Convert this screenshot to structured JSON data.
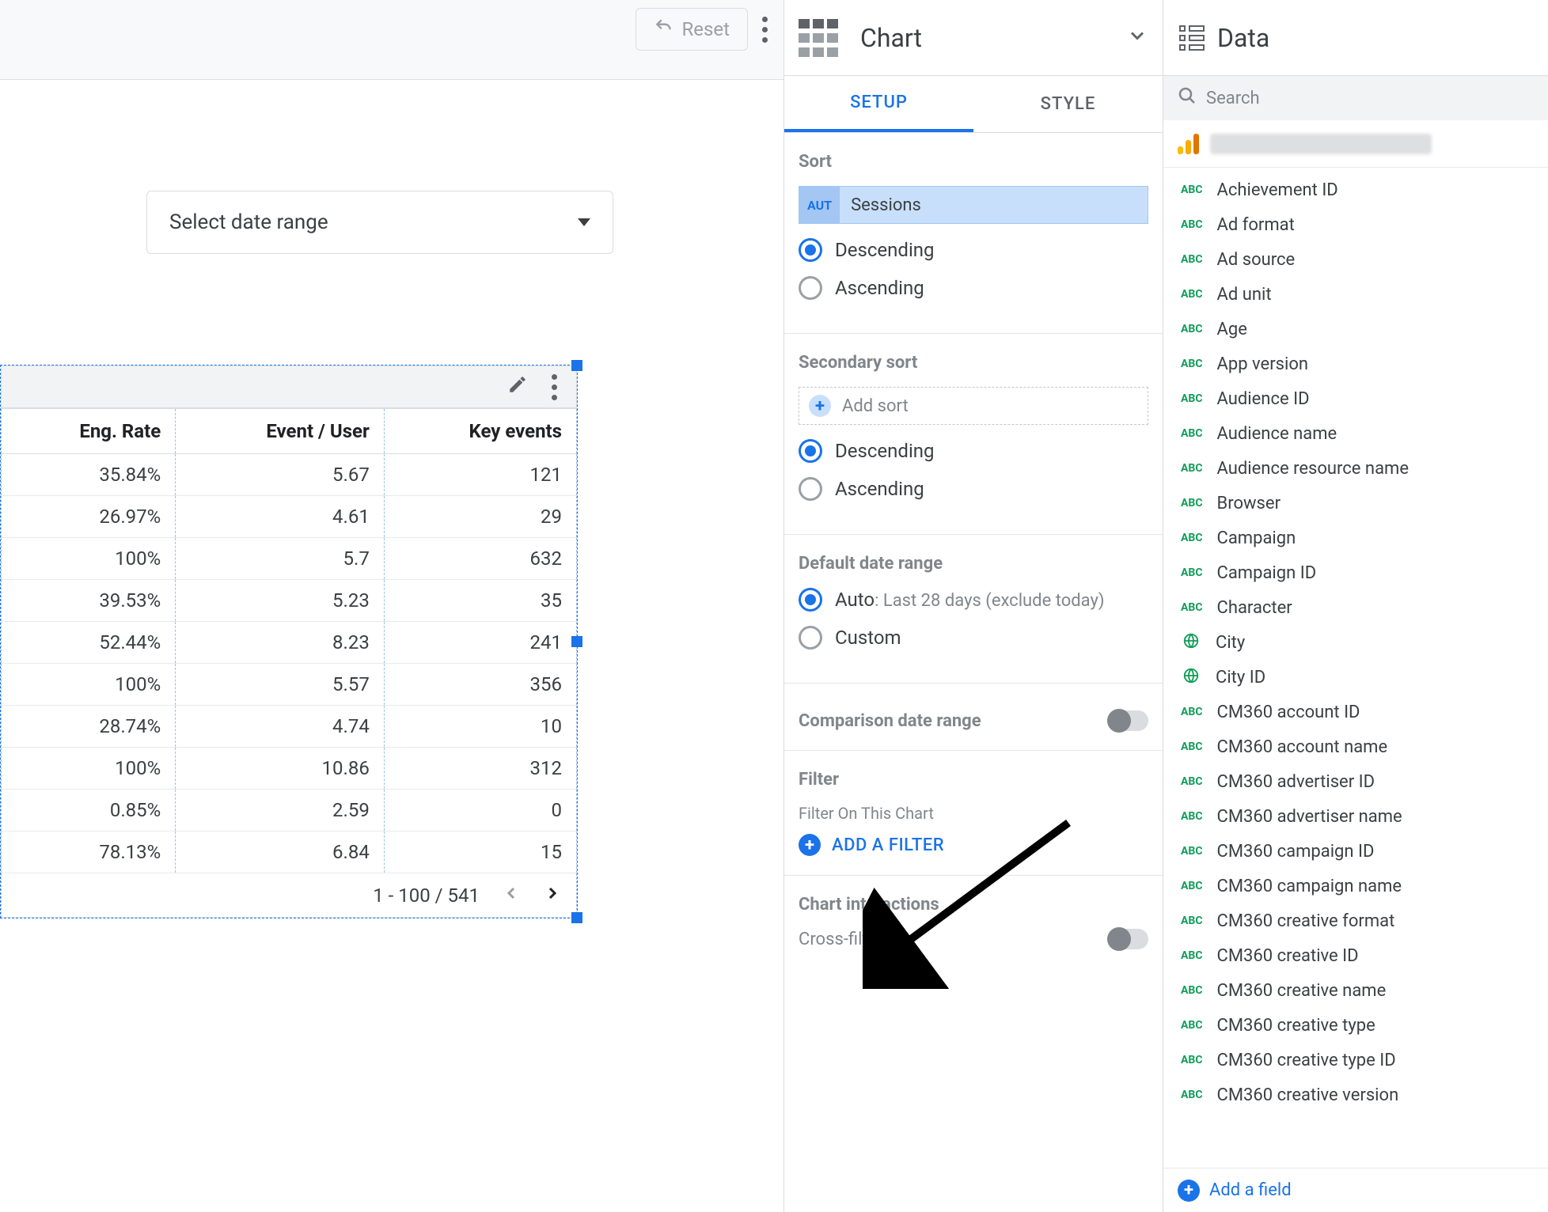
{
  "toolbar": {
    "reset_label": "Reset"
  },
  "date_range_control": {
    "label": "Select date range"
  },
  "chart_data": {
    "type": "table",
    "columns": [
      "Eng. Rate",
      "Event / User",
      "Key events"
    ],
    "rows": [
      [
        "35.84%",
        "5.67",
        "121"
      ],
      [
        "26.97%",
        "4.61",
        "29"
      ],
      [
        "100%",
        "5.7",
        "632"
      ],
      [
        "39.53%",
        "5.23",
        "35"
      ],
      [
        "52.44%",
        "8.23",
        "241"
      ],
      [
        "100%",
        "5.57",
        "356"
      ],
      [
        "28.74%",
        "4.74",
        "10"
      ],
      [
        "100%",
        "10.86",
        "312"
      ],
      [
        "0.85%",
        "2.59",
        "0"
      ],
      [
        "78.13%",
        "6.84",
        "15"
      ]
    ],
    "pagination": "1 - 100 / 541"
  },
  "setup_panel": {
    "chart_dropdown_label": "Chart",
    "tabs": {
      "setup": "SETUP",
      "style": "STYLE"
    },
    "sort": {
      "title": "Sort",
      "field_badge": "AUT",
      "field_label": "Sessions",
      "descending": "Descending",
      "ascending": "Ascending"
    },
    "secondary_sort": {
      "title": "Secondary sort",
      "add_label": "Add sort",
      "descending": "Descending",
      "ascending": "Ascending"
    },
    "default_date_range": {
      "title": "Default date range",
      "auto_label": "Auto",
      "auto_detail": ": Last 28 days (exclude today)",
      "custom_label": "Custom"
    },
    "comparison_date_range": {
      "title": "Comparison date range"
    },
    "filter": {
      "title": "Filter",
      "sub": "Filter On This Chart",
      "add_label": "ADD A FILTER"
    },
    "chart_interactions": {
      "title": "Chart interactions",
      "cross_filtering": "Cross-filtering"
    }
  },
  "data_panel": {
    "title": "Data",
    "search_placeholder": "Search",
    "fields": [
      {
        "type": "abc",
        "label": "Achievement ID"
      },
      {
        "type": "abc",
        "label": "Ad format"
      },
      {
        "type": "abc",
        "label": "Ad source"
      },
      {
        "type": "abc",
        "label": "Ad unit"
      },
      {
        "type": "abc",
        "label": "Age"
      },
      {
        "type": "abc",
        "label": "App version"
      },
      {
        "type": "abc",
        "label": "Audience ID"
      },
      {
        "type": "abc",
        "label": "Audience name"
      },
      {
        "type": "abc",
        "label": "Audience resource name"
      },
      {
        "type": "abc",
        "label": "Browser"
      },
      {
        "type": "abc",
        "label": "Campaign"
      },
      {
        "type": "abc",
        "label": "Campaign ID"
      },
      {
        "type": "abc",
        "label": "Character"
      },
      {
        "type": "geo",
        "label": "City"
      },
      {
        "type": "geo",
        "label": "City ID"
      },
      {
        "type": "abc",
        "label": "CM360 account ID"
      },
      {
        "type": "abc",
        "label": "CM360 account name"
      },
      {
        "type": "abc",
        "label": "CM360 advertiser ID"
      },
      {
        "type": "abc",
        "label": "CM360 advertiser name"
      },
      {
        "type": "abc",
        "label": "CM360 campaign ID"
      },
      {
        "type": "abc",
        "label": "CM360 campaign name"
      },
      {
        "type": "abc",
        "label": "CM360 creative format"
      },
      {
        "type": "abc",
        "label": "CM360 creative ID"
      },
      {
        "type": "abc",
        "label": "CM360 creative name"
      },
      {
        "type": "abc",
        "label": "CM360 creative type"
      },
      {
        "type": "abc",
        "label": "CM360 creative type ID"
      },
      {
        "type": "abc",
        "label": "CM360 creative version"
      }
    ],
    "add_field_label": "Add a field"
  }
}
